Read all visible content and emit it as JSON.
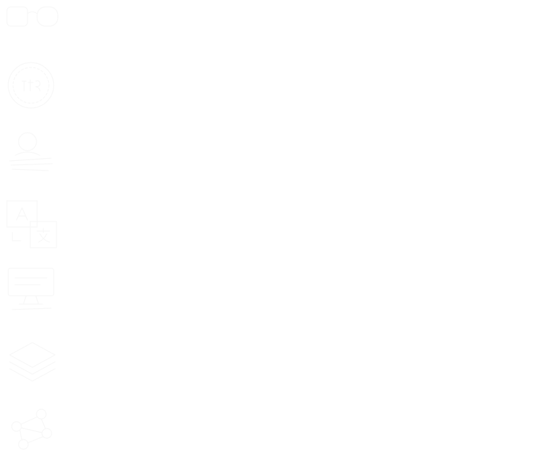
{
  "page": {
    "background": "#ffffff",
    "icon_stroke_color": "#f7f7f7",
    "icon_fill_color": "#f9f9f9"
  },
  "icons": [
    {
      "name": "glasses-icon"
    },
    {
      "name": "currency-coin-icon"
    },
    {
      "name": "user-stack-icon"
    },
    {
      "name": "translate-icon"
    },
    {
      "name": "monitor-icon"
    },
    {
      "name": "layers-icon"
    },
    {
      "name": "network-icon"
    }
  ]
}
